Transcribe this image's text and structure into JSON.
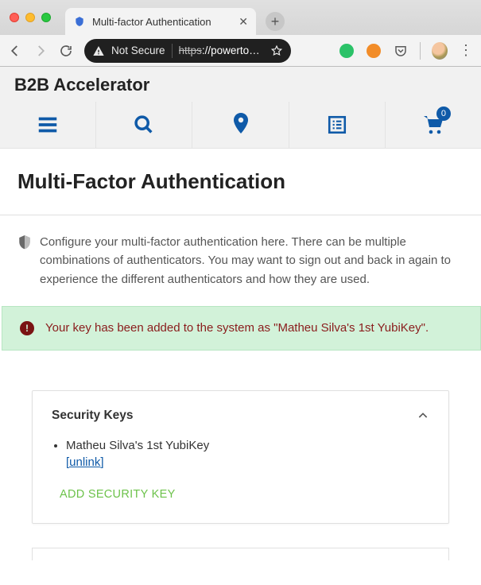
{
  "browser": {
    "tab_title": "Multi-factor Authentication",
    "not_secure_label": "Not Secure",
    "url_scheme": "https",
    "url_rest": "://powertools.l...",
    "cart_count": "0"
  },
  "brand": "B2B Accelerator",
  "page": {
    "title": "Multi-Factor Authentication",
    "intro": "Configure your multi-factor authentication here. There can be multiple combinations of authenticators. You may want to sign out and back in again to experience the different authenticators and how they are used."
  },
  "alert": {
    "message": "Your key has been added to the system as \"Matheu Silva's 1st YubiKey\"."
  },
  "security_keys": {
    "header": "Security Keys",
    "items": [
      {
        "name": "Matheu Silva's 1st YubiKey",
        "unlink_label": "[unlink]"
      }
    ],
    "add_label": "ADD SECURITY KEY"
  }
}
